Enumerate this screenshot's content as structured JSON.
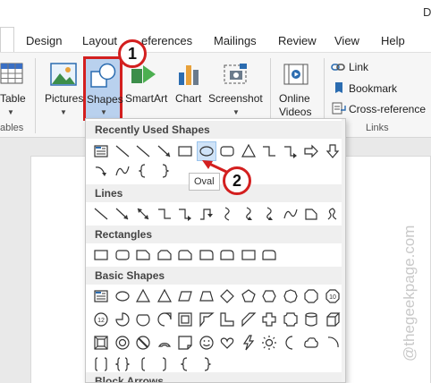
{
  "tabs": [
    {
      "label": "Design"
    },
    {
      "label": "Layout"
    },
    {
      "label": "References",
      "shown": "eferences"
    },
    {
      "label": "Mailings"
    },
    {
      "label": "Review"
    },
    {
      "label": "View"
    },
    {
      "label": "Help"
    }
  ],
  "doc_title_initial": "D",
  "ribbon": {
    "table_group": {
      "button": "Table",
      "group_label": "Tables",
      "group_label_shown": "ables"
    },
    "illustrations": {
      "pictures": "Pictures",
      "shapes": "Shapes",
      "smartart": "SmartArt",
      "chart": "Chart",
      "screenshot": "Screenshot"
    },
    "media": {
      "online_videos_line1": "Online",
      "online_videos_line2": "Videos"
    },
    "links": {
      "link": "Link",
      "bookmark": "Bookmark",
      "cross_reference": "Cross-reference",
      "group_label": "Links"
    }
  },
  "shapes_menu": {
    "sections": [
      {
        "title": "Recently Used Shapes"
      },
      {
        "title": "Lines"
      },
      {
        "title": "Rectangles"
      },
      {
        "title": "Basic Shapes"
      },
      {
        "title": "Block Arrows"
      }
    ],
    "tooltip": "Oval",
    "selected": "oval"
  },
  "callouts": [
    {
      "number": "1"
    },
    {
      "number": "2"
    }
  ],
  "watermark": "@thegeekpage.com",
  "colors": {
    "callout_border": "#d31f1f",
    "shapes_highlight": "#8fb7e4",
    "selection_fill": "#cfe3f8"
  }
}
